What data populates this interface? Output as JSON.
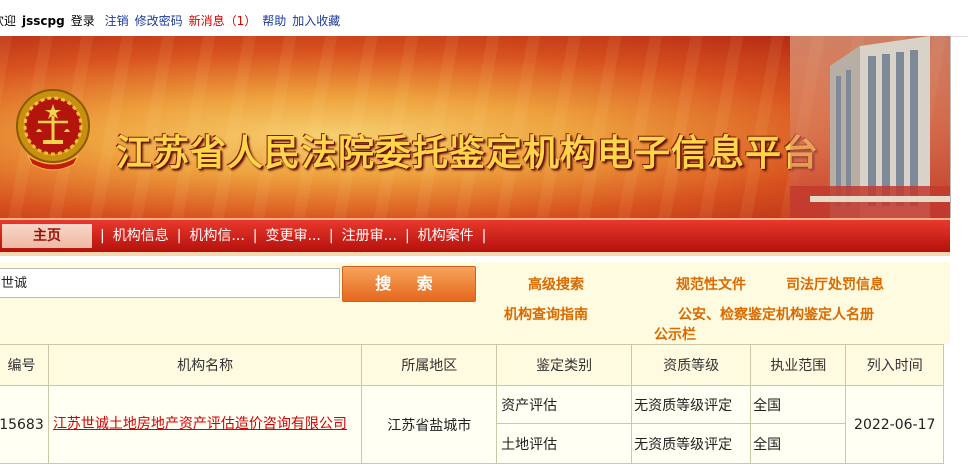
{
  "userbar": {
    "welcome": "欢迎",
    "username": "jsscpg",
    "login_label": "登录",
    "logout": "注销",
    "change_password": "修改密码",
    "new_messages": "新消息（1）",
    "help": "帮助",
    "add_favorite": "加入收藏"
  },
  "banner": {
    "title": "江苏省人民法院委托鉴定机构电子信息平台"
  },
  "nav": {
    "home": "主页",
    "items": [
      "机构信息",
      "机构信...",
      "变更审...",
      "注册审...",
      "机构案件"
    ]
  },
  "search": {
    "value": "世诚",
    "button": "搜 索"
  },
  "links": {
    "advanced_search": "高级搜索",
    "normative_docs": "规范性文件",
    "penalty_info": "司法厅处罚信息",
    "query_guide": "机构查询指南",
    "roster": "公安、检察鉴定机构鉴定人名册",
    "bulletin": "公示栏"
  },
  "table": {
    "headers": [
      "编号",
      "机构名称",
      "所属地区",
      "鉴定类别",
      "资质等级",
      "执业范围",
      "列入时间"
    ],
    "row": {
      "id": "15683",
      "name": "江苏世诚土地房地产资产评估造价咨询有限公司",
      "region": "江苏省盐城市",
      "date": "2022-06-17",
      "items": [
        {
          "category": "资产评估",
          "level": "无资质等级评定",
          "scope": "全国"
        },
        {
          "category": "土地评估",
          "level": "无资质等级评定",
          "scope": "全国"
        }
      ]
    }
  },
  "colors": {
    "nav_red": "#c4180f",
    "accent_orange": "#e5671e",
    "link_orange": "#d96a00",
    "title_gold": "#ffd54a"
  }
}
